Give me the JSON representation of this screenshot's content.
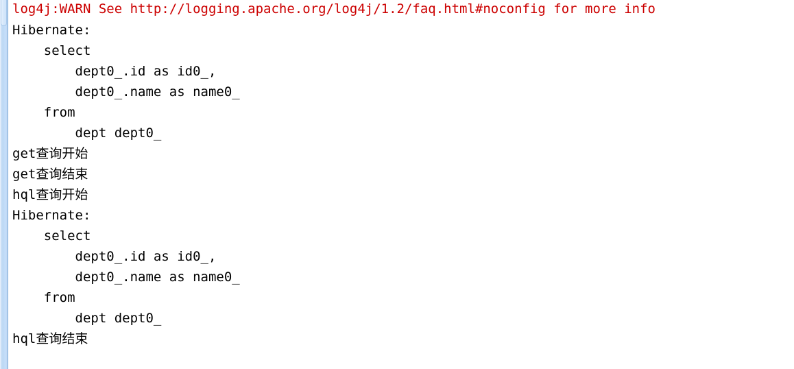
{
  "app": {
    "panel_name": "console-output",
    "text_color": "#000000",
    "warn_color": "#cc0000",
    "background_color": "#ffffff",
    "scrollbar_track_color": "#bdd7f2",
    "scrollbar_border_color": "#7fa8d4"
  },
  "scrollbar": {
    "orientation": "vertical",
    "thumb_position": "top",
    "name": "vertical-scrollbar"
  },
  "console": {
    "lines": [
      {
        "text": "log4j:WARN See http://logging.apache.org/log4j/1.2/faq.html#noconfig for more info",
        "level": "warn"
      },
      {
        "text": "Hibernate: ",
        "level": "info"
      },
      {
        "text": "    select",
        "level": "info"
      },
      {
        "text": "        dept0_.id as id0_,",
        "level": "info"
      },
      {
        "text": "        dept0_.name as name0_",
        "level": "info"
      },
      {
        "text": "    from",
        "level": "info"
      },
      {
        "text": "        dept dept0_",
        "level": "info"
      },
      {
        "text": "get查询开始",
        "level": "info"
      },
      {
        "text": "get查询结束",
        "level": "info"
      },
      {
        "text": "hql查询开始",
        "level": "info"
      },
      {
        "text": "Hibernate: ",
        "level": "info"
      },
      {
        "text": "    select",
        "level": "info"
      },
      {
        "text": "        dept0_.id as id0_,",
        "level": "info"
      },
      {
        "text": "        dept0_.name as name0_",
        "level": "info"
      },
      {
        "text": "    from",
        "level": "info"
      },
      {
        "text": "        dept dept0_",
        "level": "info"
      },
      {
        "text": "hql查询结束",
        "level": "info"
      }
    ]
  }
}
